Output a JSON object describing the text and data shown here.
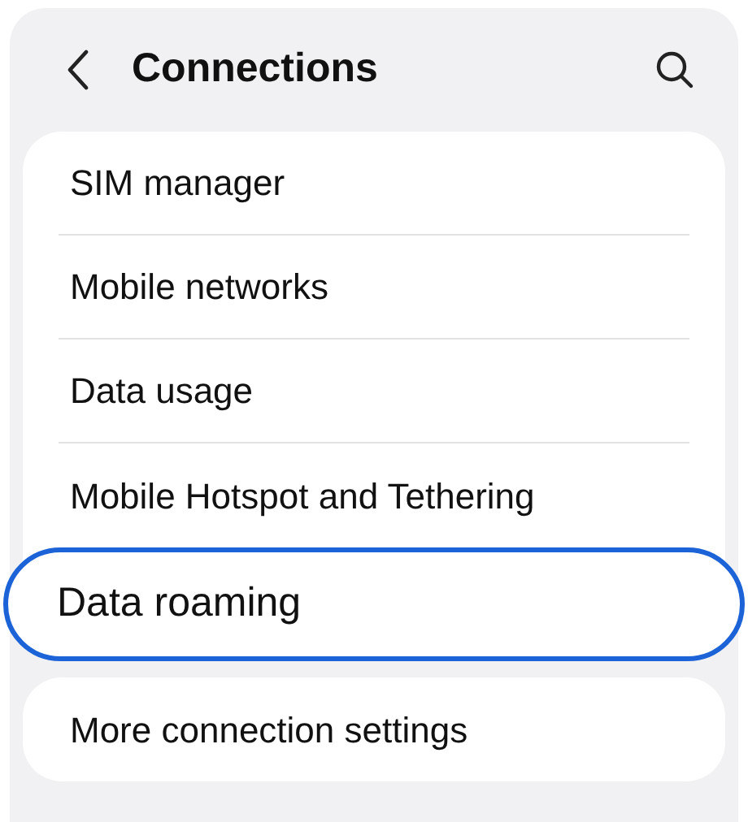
{
  "header": {
    "title": "Connections"
  },
  "groups": [
    {
      "items": [
        {
          "label": "SIM manager",
          "selected": false
        },
        {
          "label": "Mobile networks",
          "selected": false
        },
        {
          "label": "Data usage",
          "selected": false
        },
        {
          "label": "Mobile Hotspot and Tethering",
          "selected": false
        },
        {
          "label": "Data roaming",
          "selected": true
        }
      ]
    },
    {
      "items": [
        {
          "label": "More connection settings",
          "selected": false
        }
      ]
    }
  ]
}
